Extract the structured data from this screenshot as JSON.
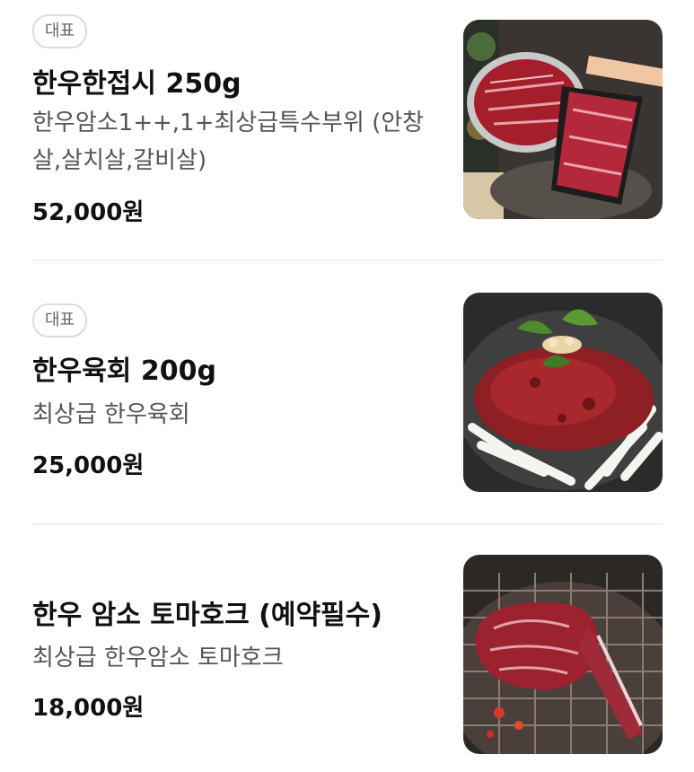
{
  "menu": {
    "items": [
      {
        "badge": "대표",
        "name": "한우한접시 250g",
        "description": "한우암소1++,1+최상급특수부위 (안창살,살치살,갈비살)",
        "price": "52,000원"
      },
      {
        "badge": "대표",
        "name": "한우육회 200g",
        "description": "최상급 한우육회",
        "price": "25,000원"
      },
      {
        "name": "한우 암소 토마호크 (예약필수)",
        "description": "최상급 한우암소 토마호크",
        "price": "18,000원"
      }
    ]
  }
}
